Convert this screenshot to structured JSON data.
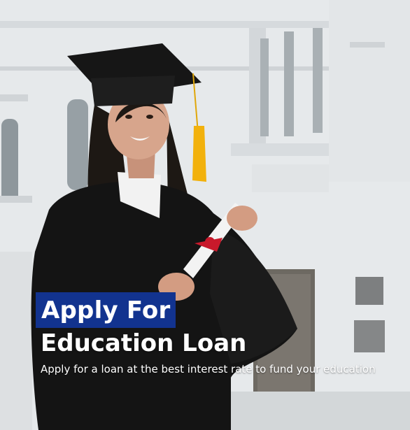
{
  "banner": {
    "headline_line1": "Apply For",
    "headline_line2": "Education Loan",
    "subtitle": "Apply for a loan at the best interest rate to fund your education",
    "image_alt": "Graduate in cap and gown holding a diploma"
  },
  "colors": {
    "headline_highlight": "#12338f",
    "text": "#ffffff",
    "gown": "#141414",
    "tassel": "#f2b10c",
    "ribbon": "#c8192b"
  }
}
